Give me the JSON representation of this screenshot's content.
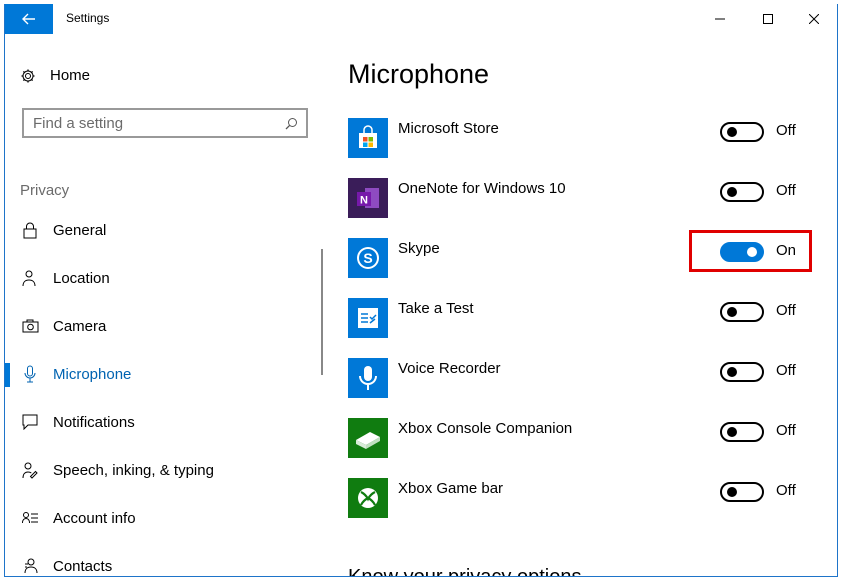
{
  "window": {
    "title": "Settings"
  },
  "sidebar": {
    "home_label": "Home",
    "search_placeholder": "Find a setting",
    "section_label": "Privacy",
    "items": [
      {
        "label": "General",
        "icon": "lock-icon",
        "active": false
      },
      {
        "label": "Location",
        "icon": "person-pin-icon",
        "active": false
      },
      {
        "label": "Camera",
        "icon": "camera-icon",
        "active": false
      },
      {
        "label": "Microphone",
        "icon": "microphone-icon",
        "active": true
      },
      {
        "label": "Notifications",
        "icon": "speech-bubble-icon",
        "active": false
      },
      {
        "label": "Speech, inking, & typing",
        "icon": "pen-person-icon",
        "active": false
      },
      {
        "label": "Account info",
        "icon": "account-list-icon",
        "active": false
      },
      {
        "label": "Contacts",
        "icon": "contacts-icon",
        "active": false
      }
    ]
  },
  "main": {
    "title": "Microphone",
    "apps": [
      {
        "name": "Microsoft Store",
        "state": "Off",
        "on": false,
        "icon": "store-bag-icon",
        "color": "#0078d7"
      },
      {
        "name": "OneNote for Windows 10",
        "state": "Off",
        "on": false,
        "icon": "onenote-icon",
        "color": "#3a1d59"
      },
      {
        "name": "Skype",
        "state": "On",
        "on": true,
        "icon": "skype-icon",
        "color": "#0078d7"
      },
      {
        "name": "Take a Test",
        "state": "Off",
        "on": false,
        "icon": "checklist-icon",
        "color": "#0078d7"
      },
      {
        "name": "Voice Recorder",
        "state": "Off",
        "on": false,
        "icon": "voice-recorder-icon",
        "color": "#0078d7"
      },
      {
        "name": "Xbox Console Companion",
        "state": "Off",
        "on": false,
        "icon": "xbox-console-icon",
        "color": "#107c10"
      },
      {
        "name": "Xbox Game bar",
        "state": "Off",
        "on": false,
        "icon": "xbox-logo-icon",
        "color": "#107c10"
      }
    ],
    "bottom_heading": "Know your privacy options"
  },
  "colors": {
    "accent": "#0078d7",
    "highlight": "#e00000"
  }
}
